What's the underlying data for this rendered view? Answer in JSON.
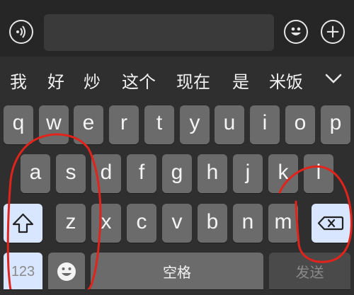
{
  "input_bar": {
    "voice_icon": "voice-waves-icon",
    "emoji_icon": "smiley-icon",
    "plus_icon": "plus-icon",
    "plus_glyph": "+"
  },
  "candidates": [
    "我",
    "好",
    "炒",
    "这个",
    "现在",
    "是",
    "米饭"
  ],
  "candidate_expand_icon": "chevron-down-icon",
  "keyboard": {
    "row1": [
      "q",
      "w",
      "e",
      "r",
      "t",
      "y",
      "u",
      "i",
      "o",
      "p"
    ],
    "row2": [
      "a",
      "s",
      "d",
      "f",
      "g",
      "h",
      "j",
      "k",
      "l"
    ],
    "row3": [
      "z",
      "x",
      "c",
      "v",
      "b",
      "n",
      "m"
    ],
    "shift_icon": "shift-arrow-icon",
    "delete_icon": "backspace-icon",
    "numbers_label": "123",
    "emoji_key_icon": "emoji-face-icon",
    "space_label": "空格",
    "send_label": "发送"
  },
  "colors": {
    "key_bg": "#6b6b6b",
    "special_key_bg": "#d8e6ff",
    "annotation_ink": "#e0241b"
  }
}
